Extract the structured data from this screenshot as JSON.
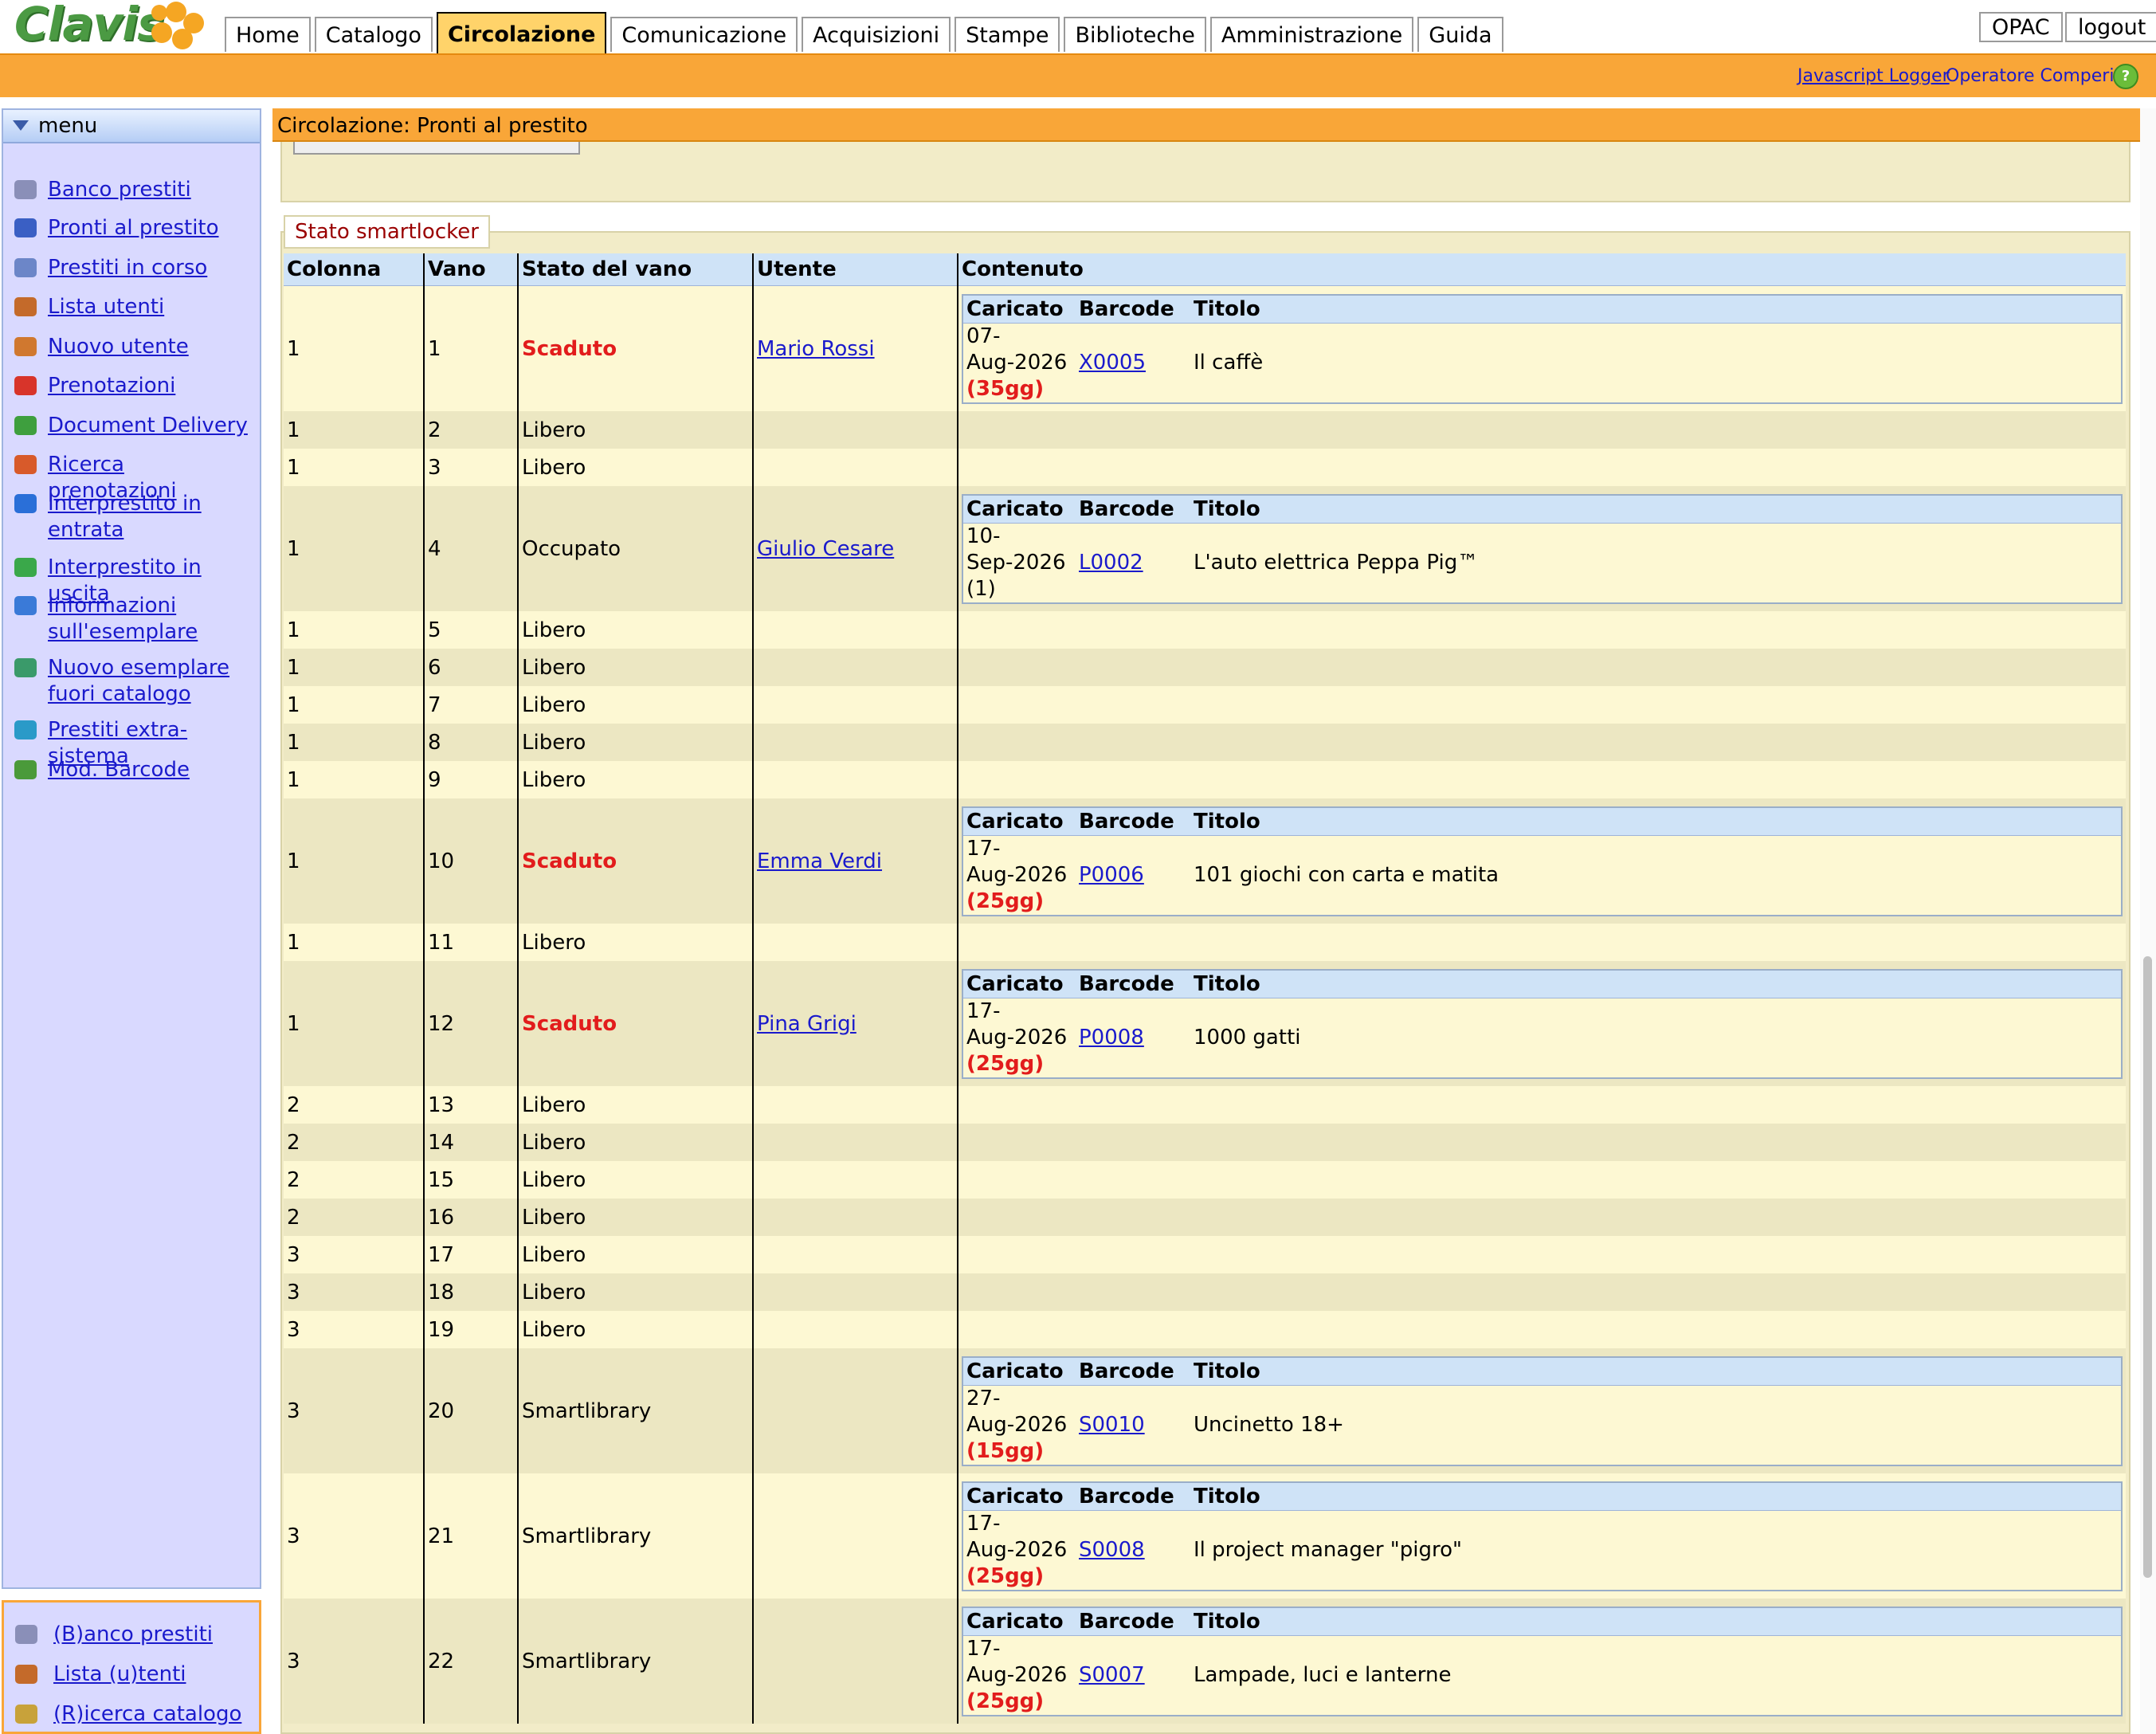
{
  "logo": {
    "text": "Clavis"
  },
  "tabs": [
    {
      "label": "Home",
      "active": false
    },
    {
      "label": "Catalogo",
      "active": false
    },
    {
      "label": "Circolazione",
      "active": true
    },
    {
      "label": "Comunicazione",
      "active": false
    },
    {
      "label": "Acquisizioni",
      "active": false
    },
    {
      "label": "Stampe",
      "active": false
    },
    {
      "label": "Biblioteche",
      "active": false
    },
    {
      "label": "Amministrazione",
      "active": false
    },
    {
      "label": "Guida",
      "active": false
    }
  ],
  "header_buttons": {
    "opac": "OPAC",
    "logout": "logout"
  },
  "subheader": {
    "js_logger": "Javascript Logger",
    "operator": "Operatore Comperio",
    "help_icon": "help-icon"
  },
  "sidebar": {
    "title": "menu",
    "items": [
      {
        "label": "Banco prestiti",
        "icon": "gears-icon",
        "color": "#8a8fb8"
      },
      {
        "label": "Pronti al prestito",
        "icon": "books-icon",
        "color": "#3a5fc4"
      },
      {
        "label": "Prestiti in corso",
        "icon": "book-open-icon",
        "color": "#6c86c8"
      },
      {
        "label": "Lista utenti",
        "icon": "users-icon",
        "color": "#c46a2a"
      },
      {
        "label": "Nuovo utente",
        "icon": "user-add-icon",
        "color": "#d0782f"
      },
      {
        "label": "Prenotazioni",
        "icon": "book-red-icon",
        "color": "#d8342a"
      },
      {
        "label": "Document Delivery",
        "icon": "document-icon",
        "color": "#3e9f3e"
      },
      {
        "label": "Ricerca prenotazioni",
        "icon": "search-book-icon",
        "color": "#d85a2a"
      },
      {
        "label": "Interprestito in entrata",
        "icon": "arrow-in-icon",
        "color": "#2a6fd8"
      },
      {
        "label": "Interprestito in uscita",
        "icon": "arrow-out-icon",
        "color": "#3aa84a"
      },
      {
        "label": "Informazioni sull'esemplare",
        "icon": "info-item-icon",
        "color": "#3a7ad8"
      },
      {
        "label": "Nuovo esemplare fuori catalogo",
        "icon": "item-add-icon",
        "color": "#3a9a6a"
      },
      {
        "label": "Prestiti extra-sistema",
        "icon": "globe-icon",
        "color": "#2a9ac8"
      },
      {
        "label": "Mod. Barcode",
        "icon": "barcode-icon",
        "color": "#4a9a3a"
      }
    ]
  },
  "quick_menu": [
    {
      "label": "(B)anco prestiti",
      "icon": "gears-icon",
      "color": "#8a8fb8"
    },
    {
      "label": "Lista (u)tenti",
      "icon": "users-icon",
      "color": "#c46a2a"
    },
    {
      "label": "(R)icerca catalogo",
      "icon": "search-icon",
      "color": "#c8a23a"
    }
  ],
  "panel": {
    "title": "Circolazione: Pronti al prestito",
    "legend": "Stato smartlocker"
  },
  "table": {
    "headers": [
      "Colonna",
      "Vano",
      "Stato del vano",
      "Utente",
      "Contenuto"
    ],
    "inner_headers": [
      "Caricato",
      "Barcode",
      "Titolo"
    ],
    "rows": [
      {
        "colonna": "1",
        "vano": "1",
        "stato": "Scaduto",
        "overdue": true,
        "utente": "Mario Rossi",
        "content": {
          "d1": "07-",
          "d2": "Aug-2026",
          "days": "(35gg)",
          "days_red": true,
          "barcode": "X0005",
          "titolo": "Il caffè"
        }
      },
      {
        "colonna": "1",
        "vano": "2",
        "stato": "Libero"
      },
      {
        "colonna": "1",
        "vano": "3",
        "stato": "Libero"
      },
      {
        "colonna": "1",
        "vano": "4",
        "stato": "Occupato",
        "utente": "Giulio Cesare",
        "content": {
          "d1": "10-",
          "d2": "Sep-2026",
          "days": "(1)",
          "days_red": false,
          "barcode": "L0002",
          "titolo": "L'auto elettrica Peppa Pig™"
        }
      },
      {
        "colonna": "1",
        "vano": "5",
        "stato": "Libero"
      },
      {
        "colonna": "1",
        "vano": "6",
        "stato": "Libero"
      },
      {
        "colonna": "1",
        "vano": "7",
        "stato": "Libero"
      },
      {
        "colonna": "1",
        "vano": "8",
        "stato": "Libero"
      },
      {
        "colonna": "1",
        "vano": "9",
        "stato": "Libero"
      },
      {
        "colonna": "1",
        "vano": "10",
        "stato": "Scaduto",
        "overdue": true,
        "utente": "Emma Verdi",
        "content": {
          "d1": "17-",
          "d2": "Aug-2026",
          "days": "(25gg)",
          "days_red": true,
          "barcode": "P0006",
          "titolo": "101 giochi con carta e matita"
        }
      },
      {
        "colonna": "1",
        "vano": "11",
        "stato": "Libero"
      },
      {
        "colonna": "1",
        "vano": "12",
        "stato": "Scaduto",
        "overdue": true,
        "utente": "Pina Grigi",
        "content": {
          "d1": "17-",
          "d2": "Aug-2026",
          "days": "(25gg)",
          "days_red": true,
          "barcode": "P0008",
          "titolo": "1000 gatti"
        }
      },
      {
        "colonna": "2",
        "vano": "13",
        "stato": "Libero"
      },
      {
        "colonna": "2",
        "vano": "14",
        "stato": "Libero"
      },
      {
        "colonna": "2",
        "vano": "15",
        "stato": "Libero"
      },
      {
        "colonna": "2",
        "vano": "16",
        "stato": "Libero"
      },
      {
        "colonna": "3",
        "vano": "17",
        "stato": "Libero"
      },
      {
        "colonna": "3",
        "vano": "18",
        "stato": "Libero"
      },
      {
        "colonna": "3",
        "vano": "19",
        "stato": "Libero"
      },
      {
        "colonna": "3",
        "vano": "20",
        "stato": "Smartlibrary",
        "content": {
          "d1": "27-",
          "d2": "Aug-2026",
          "days": "(15gg)",
          "days_red": true,
          "barcode": "S0010",
          "titolo": "Uncinetto 18+"
        }
      },
      {
        "colonna": "3",
        "vano": "21",
        "stato": "Smartlibrary",
        "content": {
          "d1": "17-",
          "d2": "Aug-2026",
          "days": "(25gg)",
          "days_red": true,
          "barcode": "S0008",
          "titolo": "Il project manager \"pigro\""
        }
      },
      {
        "colonna": "3",
        "vano": "22",
        "stato": "Smartlibrary",
        "content": {
          "d1": "17-",
          "d2": "Aug-2026",
          "days": "(25gg)",
          "days_red": true,
          "barcode": "S0007",
          "titolo": "Lampade, luci e lanterne"
        }
      }
    ]
  }
}
